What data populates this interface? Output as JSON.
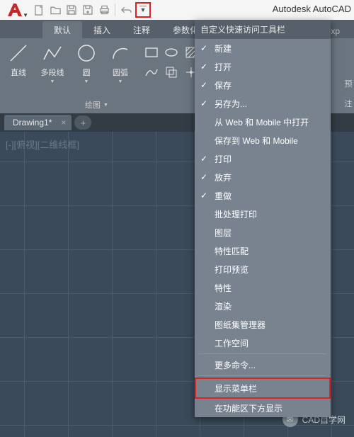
{
  "app_title": "Autodesk AutoCAD",
  "quick_access": {
    "title": "自定义快速访问工具栏",
    "items": [
      {
        "label": "新建",
        "checked": true
      },
      {
        "label": "打开",
        "checked": true
      },
      {
        "label": "保存",
        "checked": true
      },
      {
        "label": "另存为...",
        "checked": true
      },
      {
        "label": "从 Web 和 Mobile 中打开",
        "checked": false
      },
      {
        "label": "保存到 Web 和 Mobile",
        "checked": false
      },
      {
        "label": "打印",
        "checked": true
      },
      {
        "label": "放弃",
        "checked": true
      },
      {
        "label": "重做",
        "checked": true
      },
      {
        "label": "批处理打印",
        "checked": false
      },
      {
        "label": "图层",
        "checked": false
      },
      {
        "label": "特性匹配",
        "checked": false
      },
      {
        "label": "打印预览",
        "checked": false
      },
      {
        "label": "特性",
        "checked": false
      },
      {
        "label": "渲染",
        "checked": false
      },
      {
        "label": "图纸集管理器",
        "checked": false
      },
      {
        "label": "工作空间",
        "checked": false
      }
    ],
    "more_commands": "更多命令...",
    "show_menu_bar": "显示菜单栏",
    "below_ribbon": "在功能区下方显示"
  },
  "ribbon": {
    "tabs": [
      "默认",
      "插入",
      "注释",
      "参数化"
    ],
    "extra_tab": "Exp",
    "active_tab": 0,
    "tools": {
      "line": "直线",
      "polyline": "多段线",
      "circle": "圆",
      "arc": "圆弧"
    },
    "panel_title": "绘图",
    "right_labels": [
      "预",
      "注"
    ]
  },
  "file_tab": "Drawing1*",
  "view_label": "[-][俯视][二维线框]",
  "watermark": "CAD自学网"
}
